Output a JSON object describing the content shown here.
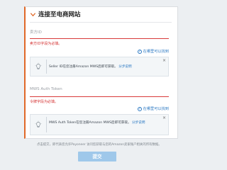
{
  "section": {
    "title": "连接至电商网站"
  },
  "seller_id": {
    "label": "卖方ID",
    "error": "卖方ID字段为必填。",
    "help": "在哪里可以找到",
    "info_text": "Seller ID在您注册Amazon MWS后即可获取。",
    "info_link": "分步说明"
  },
  "auth_token": {
    "label": "MWS Auth Token",
    "error": "令牌字段为必填。",
    "help": "在哪里可以找到",
    "info_text": "MWS Auth Token在您注册Amazon MWS后即可获取。",
    "info_link": "分步说明"
  },
  "footer": {
    "note": "点击提交，即代表您允许Payoneer 访问您获取与您的Amazon卖家账户相关的所有数据。"
  },
  "submit": {
    "label": "提交"
  },
  "colors": {
    "accent": "#e06828",
    "error": "#d32f2f",
    "link": "#2a78c2",
    "button": "#9fc8ea"
  },
  "icons": [
    "chevron-down-icon",
    "question-icon",
    "lightbulb-icon",
    "close-icon"
  ]
}
